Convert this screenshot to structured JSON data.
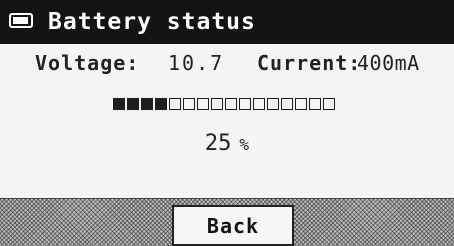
{
  "header": {
    "title": "Battery status",
    "icon": "battery-icon"
  },
  "readouts": {
    "voltage_label": "Voltage:",
    "voltage_value": "10.7",
    "current_label": "Current:",
    "current_value": "400mA"
  },
  "charge": {
    "percent_value": "25",
    "percent_unit": "%",
    "level_fraction": 0.25,
    "filled_segments": 4,
    "total_segments": 16
  },
  "footer": {
    "back_label": "Back"
  },
  "colors": {
    "title_bar": "#141414",
    "screen_bg": "#f3f4f5",
    "text": "#222222"
  }
}
